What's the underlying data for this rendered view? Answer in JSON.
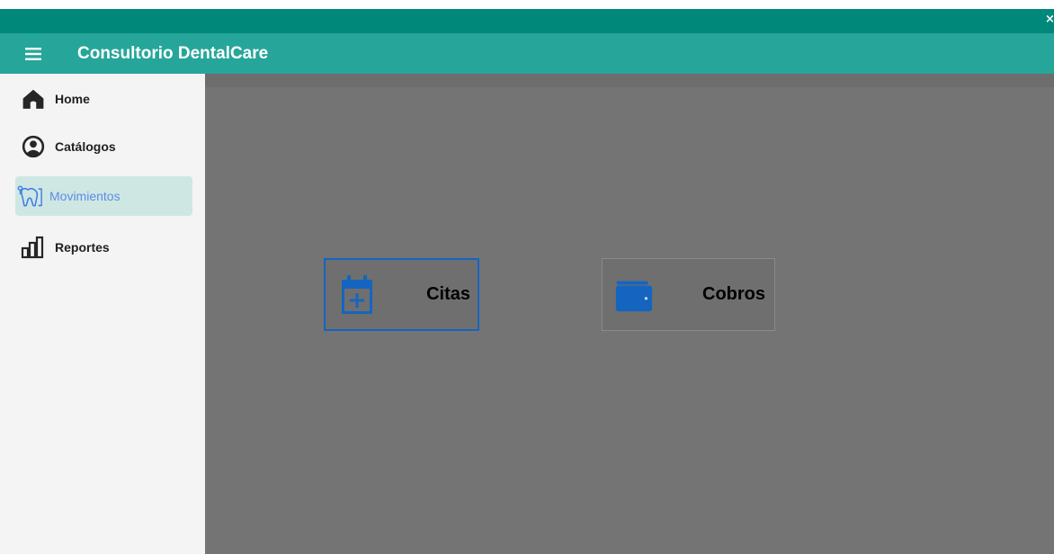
{
  "window": {
    "close_glyph": "×"
  },
  "appbar": {
    "title": "Consultorio DentalCare",
    "menu_icon": "menu-icon"
  },
  "sidebar": {
    "items": [
      {
        "label": "Home",
        "icon": "home-icon",
        "active": false
      },
      {
        "label": "Catálogos",
        "icon": "account-circle-icon",
        "active": false
      },
      {
        "label": "Movimientos",
        "icon": "tooth-icon",
        "active": true
      },
      {
        "label": "Reportes",
        "icon": "bar-chart-icon",
        "active": false
      }
    ]
  },
  "main": {
    "tiles": [
      {
        "label": "Citas",
        "icon": "calendar-plus-icon",
        "selected": true
      },
      {
        "label": "Cobros",
        "icon": "wallet-icon",
        "selected": false
      }
    ]
  },
  "colors": {
    "titlebar": "#00897b",
    "appbar": "#26a69a",
    "sidebar_bg": "#f4f4f4",
    "active_item_bg": "#cfe7e3",
    "active_item_text": "#5c8de8",
    "content_bg": "#747474",
    "tile_icon": "#1565c0"
  }
}
